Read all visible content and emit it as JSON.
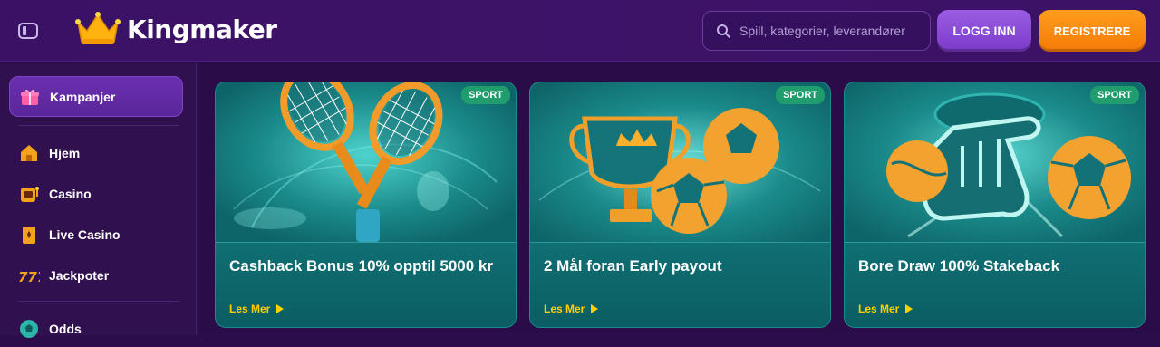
{
  "header": {
    "brand": "Kingmaker",
    "search_placeholder": "Spill, kategorier, leverandører",
    "login_label": "LOGG INN",
    "register_label": "REGISTRERE"
  },
  "sidebar": {
    "featured": {
      "label": "Kampanjer",
      "icon": "gift-icon"
    },
    "items": [
      {
        "label": "Hjem",
        "icon": "home-icon"
      },
      {
        "label": "Casino",
        "icon": "slot-machine-icon"
      },
      {
        "label": "Live Casino",
        "icon": "playing-card-icon"
      },
      {
        "label": "Jackpoter",
        "icon": "jackpot-777-icon"
      },
      {
        "label": "Odds",
        "icon": "soccer-ball-icon"
      }
    ]
  },
  "cards": [
    {
      "badge": "SPORT",
      "title": "Cashback Bonus 10% opptil 5000 kr",
      "more": "Les Mer",
      "art": "tennis-rackets"
    },
    {
      "badge": "SPORT",
      "title": "2 Mål foran Early payout",
      "more": "Les Mer",
      "art": "trophy-footballs"
    },
    {
      "badge": "SPORT",
      "title": "Bore Draw 100% Stakeback",
      "more": "Les Mer",
      "art": "foam-finger-balls"
    }
  ],
  "colors": {
    "header_bg": "#3a1265",
    "sidebar_bg": "#30104f",
    "login_button": "#8a4bd6",
    "register_button": "#f58a10",
    "card_teal": "#168082",
    "badge_green": "#1f9d6d",
    "link_yellow": "#ffd000"
  }
}
